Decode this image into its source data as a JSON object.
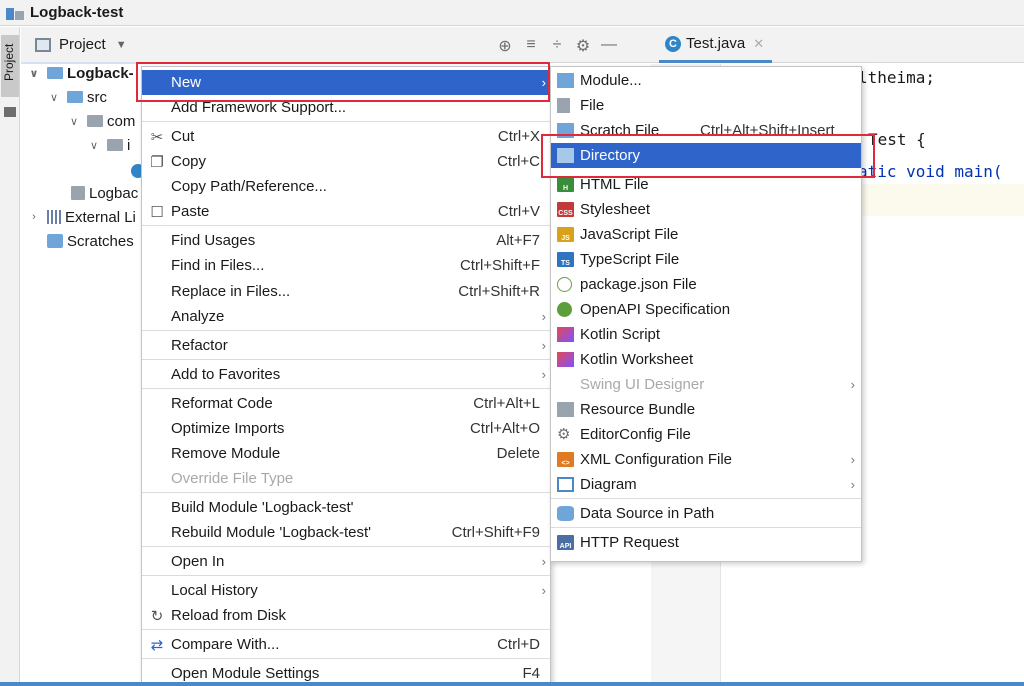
{
  "window": {
    "title": "Logback-test"
  },
  "side_strip": {
    "label": "Project"
  },
  "project_toolbar": {
    "label": "Project",
    "dropdown_icon": "chevron-down-icon"
  },
  "editor": {
    "tab_label": "Test.java",
    "code_lines": [
      "ltheima;",
      "Test {",
      "atic void main("
    ]
  },
  "tree": {
    "root": "Logback-",
    "src": "src",
    "com": "com",
    "sub": "i",
    "iml": "Logbac",
    "external": "External Li",
    "scratches": "Scratches"
  },
  "context_menu": {
    "new": "New",
    "add_framework": "Add Framework Support...",
    "cut": "Cut",
    "cut_sc": "Ctrl+X",
    "copy": "Copy",
    "copy_sc": "Ctrl+C",
    "copy_path": "Copy Path/Reference...",
    "paste": "Paste",
    "paste_sc": "Ctrl+V",
    "find_usages": "Find Usages",
    "find_usages_sc": "Alt+F7",
    "find_in_files": "Find in Files...",
    "find_in_files_sc": "Ctrl+Shift+F",
    "replace_in_files": "Replace in Files...",
    "replace_in_files_sc": "Ctrl+Shift+R",
    "analyze": "Analyze",
    "refactor": "Refactor",
    "add_favorites": "Add to Favorites",
    "reformat": "Reformat Code",
    "reformat_sc": "Ctrl+Alt+L",
    "optimize": "Optimize Imports",
    "optimize_sc": "Ctrl+Alt+O",
    "remove_module": "Remove Module",
    "remove_module_sc": "Delete",
    "override_type": "Override File Type",
    "build_module": "Build Module 'Logback-test'",
    "rebuild_module": "Rebuild Module 'Logback-test'",
    "rebuild_module_sc": "Ctrl+Shift+F9",
    "open_in": "Open In",
    "local_history": "Local History",
    "reload": "Reload from Disk",
    "compare": "Compare With...",
    "compare_sc": "Ctrl+D",
    "module_settings": "Open Module Settings",
    "module_settings_sc": "F4"
  },
  "submenu": {
    "module": "Module...",
    "file": "File",
    "scratch": "Scratch File",
    "scratch_sc": "Ctrl+Alt+Shift+Insert",
    "directory": "Directory",
    "html": "HTML File",
    "stylesheet": "Stylesheet",
    "javascript": "JavaScript File",
    "typescript": "TypeScript File",
    "package_json": "package.json File",
    "openapi": "OpenAPI Specification",
    "kotlin_script": "Kotlin Script",
    "kotlin_worksheet": "Kotlin Worksheet",
    "swing": "Swing UI Designer",
    "resource_bundle": "Resource Bundle",
    "editorconfig": "EditorConfig File",
    "xml_config": "XML Configuration File",
    "diagram": "Diagram",
    "data_source": "Data Source in Path",
    "http_request": "HTTP Request"
  },
  "colors": {
    "selection": "#2f65ca",
    "annotation": "#e0293a"
  }
}
